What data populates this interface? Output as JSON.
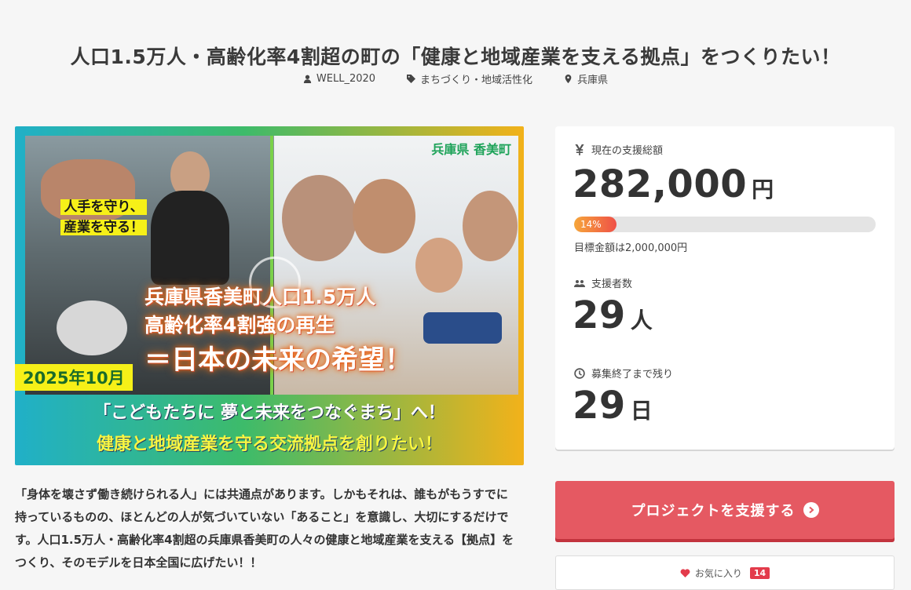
{
  "project": {
    "title": "人口1.5万人・高齢化率4割超の町の「健康と地域産業を支える拠点」をつくりたい！",
    "owner": "WELL_2020",
    "category": "まちづくり・地域活性化",
    "location": "兵庫県"
  },
  "hero": {
    "prefecture_label": "兵庫県 香美町",
    "tag_line1": "人手を守り、",
    "tag_line2": "産業を守る！",
    "main_line1": "兵庫県香美町人口1.5万人",
    "main_line2": "高齢化率4割強の再生",
    "main_line3": "＝日本の未来の希望！",
    "date_label": "2025年10月",
    "band_line1": "「こどもたちに 夢と未来をつなぐまち」へ！",
    "band_line2": "健康と地域産業を守る交流拠点を創りたい！"
  },
  "description": "「身体を壊さず働き続けられる人」には共通点があります。しかもそれは、誰もがもうすでに持っているものの、ほとんどの人が気づいていない「あること」を意識し、大切にするだけです。人口1.5万人・高齢化率4割超の兵庫県香美町の人々の健康と地域産業を支える【拠点】をつくり、そのモデルを日本全国に広げたい！！",
  "stats": {
    "funding_label": "現在の支援総額",
    "funding_amount": "282,000",
    "funding_unit": "円",
    "progress_percent": 14,
    "progress_label": "14%",
    "goal_label": "目標金額は2,000,000円",
    "backers_label": "支援者数",
    "backers_count": "29",
    "backers_unit": "人",
    "remaining_label": "募集終了まで残り",
    "remaining_count": "29",
    "remaining_unit": "日"
  },
  "actions": {
    "support_label": "プロジェクトを支援する",
    "favorite_label": "お気に入り",
    "favorite_count": "14"
  },
  "colors": {
    "accent": "#e55962",
    "progress_start": "#f6a63a",
    "progress_end": "#ef5047",
    "favorite": "#e33b4b"
  },
  "icons": {
    "owner": "user-icon",
    "category": "tag-icon",
    "location": "map-pin-icon",
    "funding": "yen-icon",
    "backers": "users-icon",
    "remaining": "clock-icon",
    "support": "arrow-circle-right-icon",
    "favorite": "heart-icon"
  }
}
